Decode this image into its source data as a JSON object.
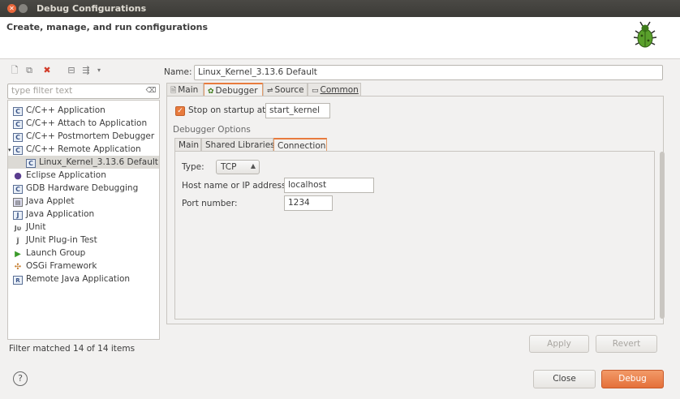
{
  "window": {
    "title": "Debug Configurations"
  },
  "header": {
    "title": "Create, manage, and run configurations"
  },
  "filter": {
    "placeholder": "type filter text"
  },
  "tree": {
    "items": [
      {
        "label": "C/C++ Application",
        "icon": "c-config-icon"
      },
      {
        "label": "C/C++ Attach to Application",
        "icon": "c-config-icon"
      },
      {
        "label": "C/C++ Postmortem Debugger",
        "icon": "c-config-icon"
      },
      {
        "label": "C/C++ Remote Application",
        "icon": "c-config-icon",
        "expanded": true
      },
      {
        "label": "Linux_Kernel_3.13.6 Default",
        "icon": "c-config-icon",
        "selected": true,
        "child": true
      },
      {
        "label": "Eclipse Application",
        "icon": "eclipse-icon"
      },
      {
        "label": "GDB Hardware Debugging",
        "icon": "c-config-icon"
      },
      {
        "label": "Java Applet",
        "icon": "applet-icon"
      },
      {
        "label": "Java Application",
        "icon": "java-icon"
      },
      {
        "label": "JUnit",
        "icon": "junit-icon"
      },
      {
        "label": "JUnit Plug-in Test",
        "icon": "junit-plugin-icon"
      },
      {
        "label": "Launch Group",
        "icon": "launch-group-icon"
      },
      {
        "label": "OSGi Framework",
        "icon": "osgi-icon"
      },
      {
        "label": "Remote Java Application",
        "icon": "remote-java-icon"
      }
    ]
  },
  "filter_status": "Filter matched 14 of 14 items",
  "config": {
    "name_label": "Name:",
    "name": "Linux_Kernel_3.13.6 Default",
    "tabs": [
      "Main",
      "Debugger",
      "Source",
      "Common"
    ],
    "active_tab": "Debugger",
    "stop_on_startup_label": "Stop on startup at:",
    "stop_on_startup_checked": true,
    "stop_on_startup_value": "start_kernel",
    "debugger_options_label": "Debugger Options",
    "subtabs": [
      "Main",
      "Shared Libraries",
      "Connection"
    ],
    "active_subtab": "Connection",
    "type_label": "Type:",
    "type_value": "TCP",
    "host_label": "Host name or IP address:",
    "host_value": "localhost",
    "port_label": "Port number:",
    "port_value": "1234"
  },
  "buttons": {
    "apply": "Apply",
    "revert": "Revert",
    "close": "Close",
    "debug": "Debug",
    "help": "?"
  },
  "colors": {
    "accent": "#e87b3e",
    "titlebar": "#3c3b37"
  }
}
